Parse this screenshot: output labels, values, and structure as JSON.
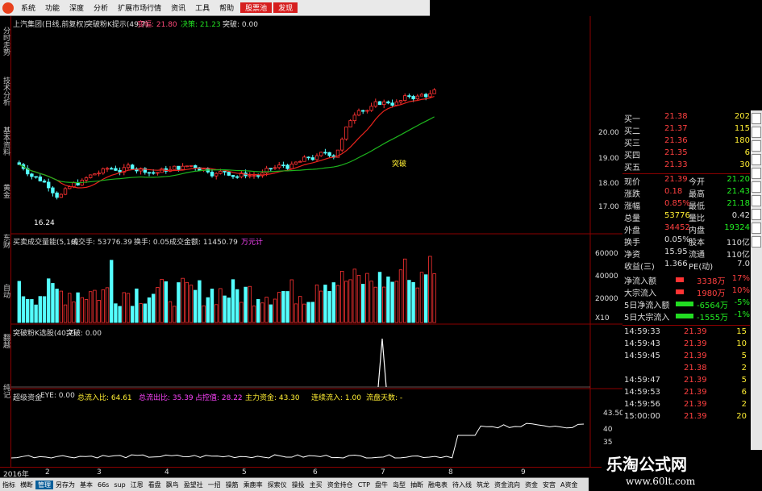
{
  "menu": {
    "items": [
      "系统",
      "功能",
      "深度",
      "分析",
      "扩展市场行情",
      "资讯",
      "工具",
      "帮助"
    ],
    "highlight1": "股票池",
    "highlight2": "发现"
  },
  "left_tabs": [
    "分时走势",
    "技术分析",
    "基本资料",
    "黄金",
    "东财",
    "自动",
    "翻越",
    "纯记",
    "龙虎",
    "指数",
    "数据",
    "云赢",
    "沪市"
  ],
  "chart": {
    "title": "上汽集团(日线,前复权)",
    "indicator_title": "突破粉K提示(49,7)",
    "label_change": "变幅: 21.80",
    "label_close": "决策: 21.23",
    "label_break": "突破: 0.00",
    "low_label": "16.24",
    "annotation": "突破",
    "price_axis": [
      "20.00",
      "19.00",
      "18.00",
      "17.00"
    ],
    "vol_title": "买卖成交量能(5,10)",
    "vol_amount": "成交手: 53776.39",
    "vol_turnover": "换手: 0.05",
    "vol_money": "成交金额: 11450.79",
    "vol_unit": "万元计",
    "vol_axis": [
      "60000",
      "40000",
      "20000",
      "X10"
    ],
    "ind2_title": "突破粉K选股(40,7)",
    "ind2_value": "突破: 0.00",
    "ind3_title": "超级资金",
    "ind3_eye": "EYE: 0.00",
    "ind3_total": "总流入比: 64.61",
    "ind3_ratio": "总流出比: 35.39",
    "ind3_point": "占控值: 28.22",
    "ind3_main": "主力资金: 43.30",
    "ind3_cont": "连续流入: 1.00",
    "ind3_days": "流盘天数: -",
    "ind3_axis": [
      "43.50",
      "40",
      "35",
      "30",
      "25"
    ],
    "date_axis": [
      "2016年",
      "2",
      "3",
      "4",
      "5",
      "6",
      "7",
      "8",
      "9"
    ],
    "date_axis_end": "日"
  },
  "quote": {
    "asks": [
      {
        "label": "买一",
        "price": "21.38",
        "vol": "202"
      },
      {
        "label": "买二",
        "price": "21.37",
        "vol": "115"
      },
      {
        "label": "买三",
        "price": "21.36",
        "vol": "180"
      },
      {
        "label": "买四",
        "price": "21.35",
        "vol": "6"
      },
      {
        "label": "买五",
        "price": "21.33",
        "vol": "30"
      }
    ],
    "stats": [
      {
        "l1": "现价",
        "v1": "21.39",
        "l2": "今开",
        "v2": "21.20"
      },
      {
        "l1": "涨跌",
        "v1": "0.18",
        "l2": "最高",
        "v2": "21.43"
      },
      {
        "l1": "涨幅",
        "v1": "0.85%",
        "l2": "最低",
        "v2": "21.18"
      },
      {
        "l1": "总量",
        "v1": "53776",
        "l2": "量比",
        "v2": "0.42"
      },
      {
        "l1": "外盘",
        "v1": "34452",
        "l2": "内盘",
        "v2": "19324"
      },
      {
        "l1": "换手",
        "v1": "0.05%",
        "l2": "股本",
        "v2": "110亿"
      },
      {
        "l1": "净资",
        "v1": "15.95",
        "l2": "流通",
        "v2": "110亿"
      },
      {
        "l1": "收益(三)",
        "v1": "1.366",
        "l2": "PE(动)",
        "v2": "7.0"
      }
    ],
    "flows": [
      {
        "label": "净流入额",
        "value": "3338万",
        "pct": "17%"
      },
      {
        "label": "大宗流入",
        "value": "1980万",
        "pct": "10%"
      },
      {
        "label": "5日净流入额",
        "value": "-6564万",
        "pct": "-5%"
      },
      {
        "label": "5日大宗流入",
        "value": "-1555万",
        "pct": "-1%"
      }
    ],
    "ticks": [
      {
        "time": "14:59:33",
        "price": "21.39",
        "vol": "15"
      },
      {
        "time": "14:59:43",
        "price": "21.39",
        "vol": "10"
      },
      {
        "time": "14:59:45",
        "price": "21.39",
        "vol": "5"
      },
      {
        "time": "",
        "price": "21.38",
        "vol": "2"
      },
      {
        "time": "14:59:47",
        "price": "21.39",
        "vol": "5"
      },
      {
        "time": "14:59:53",
        "price": "21.39",
        "vol": "6"
      },
      {
        "time": "14:59:56",
        "price": "21.39",
        "vol": "2"
      },
      {
        "time": "15:00:00",
        "price": "21.39",
        "vol": "20"
      }
    ]
  },
  "bottom_tabs": [
    "指标",
    "横断",
    "管理",
    "另存为",
    "基本",
    "66s",
    "sup",
    "江恩",
    "看盘",
    "飘鸟",
    "盈望社",
    "一招",
    "操筋",
    "乘鹿率",
    "探索仪",
    "操投",
    "主买",
    "资金持仓",
    "CTP",
    "盘牛",
    "岛型",
    "抽断",
    "融电表",
    "待入线",
    "筑龙",
    "资金流向",
    "资金",
    "安宫",
    "A资金"
  ],
  "bottom_active": "管理",
  "watermark": {
    "title": "乐淘公式网",
    "url": "www.60lt.com"
  },
  "colors": {
    "up": "#ff3232",
    "down": "#54ffff",
    "ma1": "#e8231c",
    "ma2": "#1db31d",
    "accent": "#e8401c"
  }
}
